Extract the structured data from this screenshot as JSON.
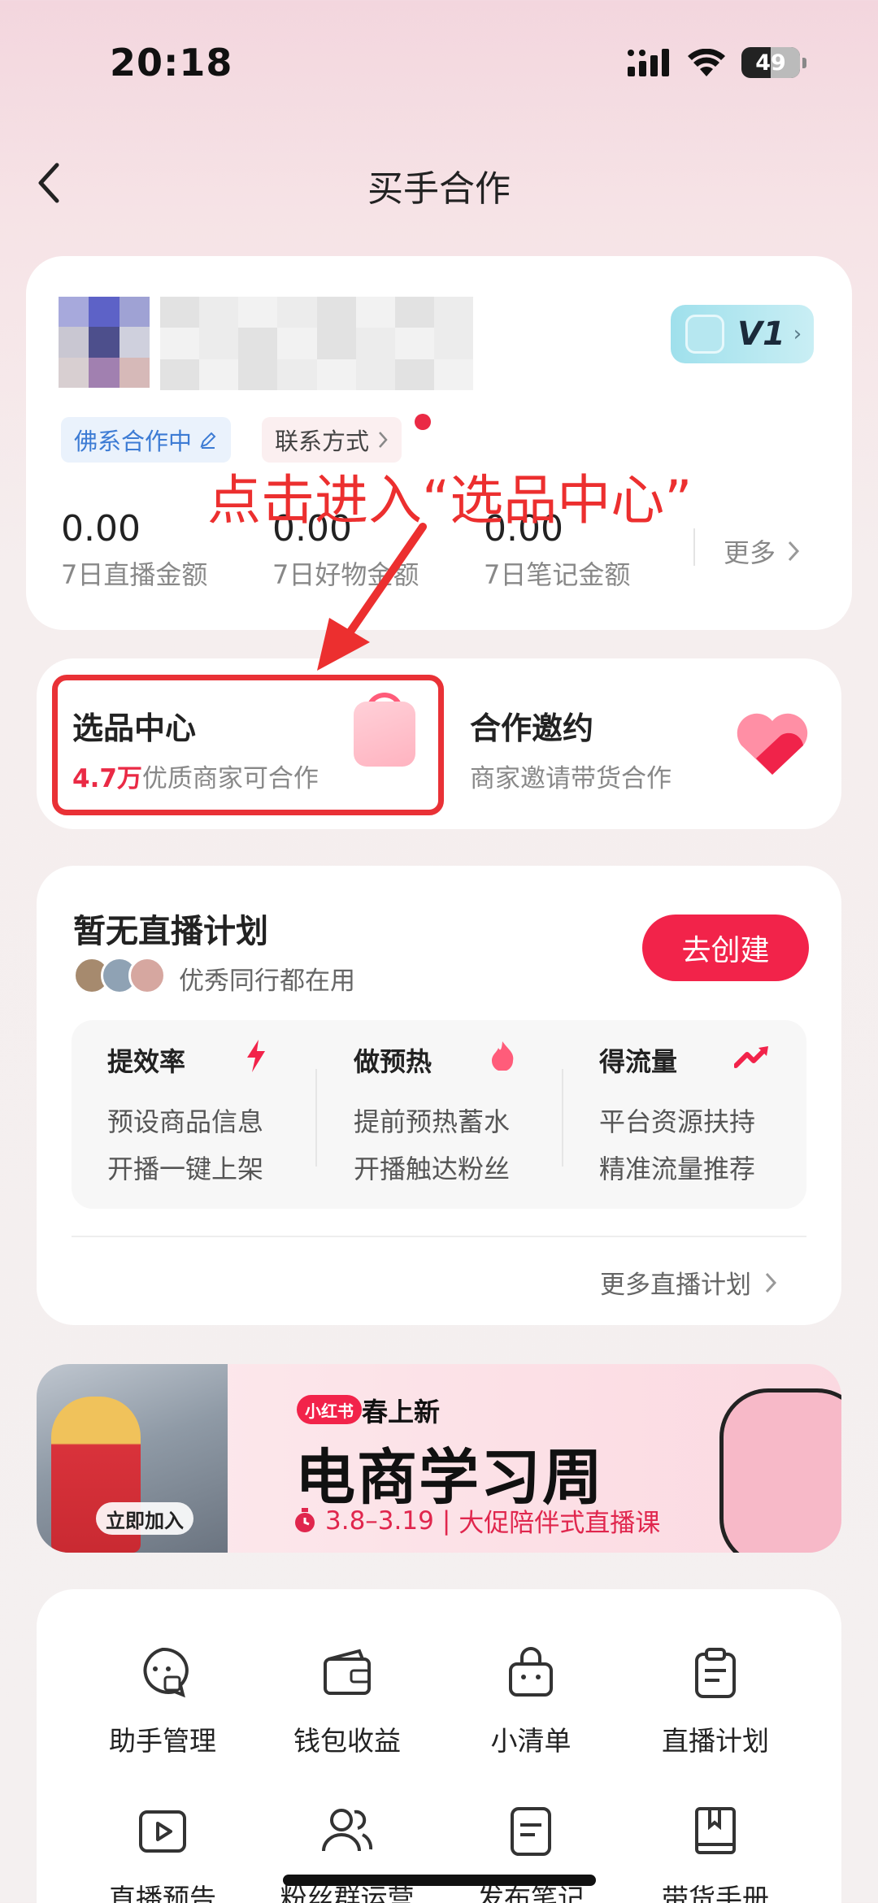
{
  "status_bar": {
    "time": "20:18",
    "battery": "49"
  },
  "nav": {
    "title": "买手合作"
  },
  "profile": {
    "level_badge": "V1",
    "tag_status": "佛系合作中",
    "tag_contact": "联系方式",
    "stats": [
      {
        "value": "0.00",
        "label": "7日直播金额"
      },
      {
        "value": "0.00",
        "label": "7日好物金额"
      },
      {
        "value": "0.00",
        "label": "7日笔记金额"
      }
    ],
    "more": "更多"
  },
  "annotation": {
    "text": "点击进入“选品中心”"
  },
  "selection": {
    "center_title": "选品中心",
    "center_count": "4.7万",
    "center_sub": "优质商家可合作",
    "invite_title": "合作邀约",
    "invite_sub": "商家邀请带货合作"
  },
  "live_plan": {
    "title": "暂无直播计划",
    "subtitle": "优秀同行都在用",
    "create_button": "去创建",
    "features": [
      {
        "title": "提效率",
        "lines": [
          "预设商品信息",
          "开播一键上架"
        ]
      },
      {
        "title": "做预热",
        "lines": [
          "提前预热蓄水",
          "开播触达粉丝"
        ]
      },
      {
        "title": "得流量",
        "lines": [
          "平台资源扶持",
          "精准流量推荐"
        ]
      }
    ],
    "more": "更多直播计划"
  },
  "banner": {
    "logo": "小红书",
    "kicker": "春上新",
    "title": "电商学习周",
    "date": "3.8–3.19",
    "date_suffix": "大促陪伴式直播课",
    "join": "立即加入"
  },
  "tools": [
    {
      "label": "助手管理",
      "icon": "assistant-icon"
    },
    {
      "label": "钱包收益",
      "icon": "wallet-icon"
    },
    {
      "label": "小清单",
      "icon": "shopping-bag-icon"
    },
    {
      "label": "直播计划",
      "icon": "clipboard-icon"
    },
    {
      "label": "直播预告",
      "icon": "play-icon"
    },
    {
      "label": "粉丝群运营",
      "icon": "group-icon"
    },
    {
      "label": "发布笔记",
      "icon": "note-icon"
    },
    {
      "label": "带货手册",
      "icon": "book-icon"
    }
  ],
  "colors": {
    "accent": "#f2234a",
    "annotation": "#ec2f2f",
    "link_blue": "#3c7bd4"
  }
}
